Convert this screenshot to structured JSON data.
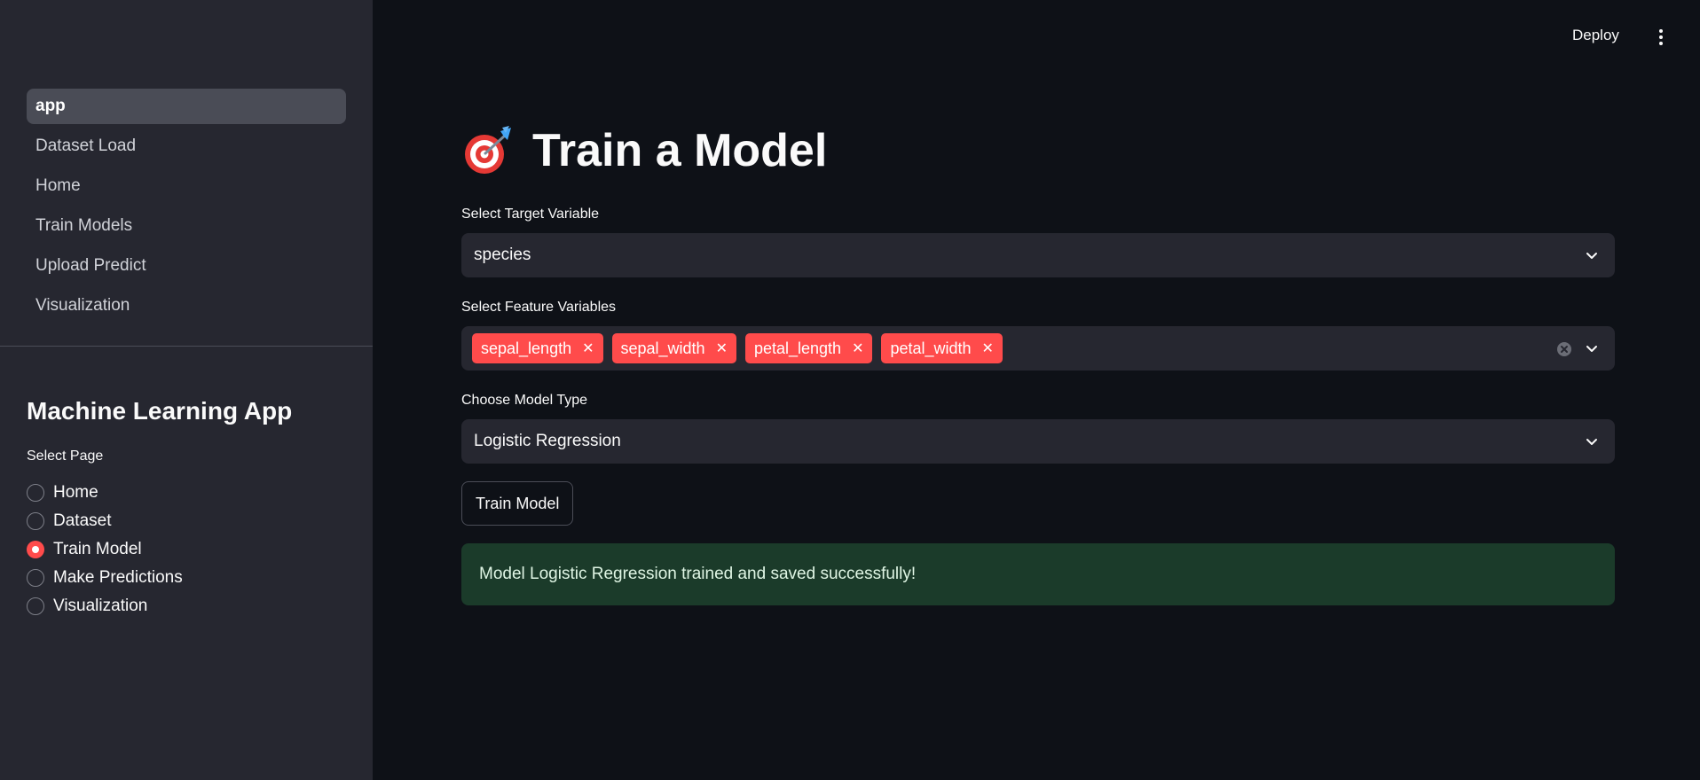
{
  "sidebar": {
    "nav": [
      {
        "label": "app",
        "active": true
      },
      {
        "label": "Dataset Load",
        "active": false
      },
      {
        "label": "Home",
        "active": false
      },
      {
        "label": "Train Models",
        "active": false
      },
      {
        "label": "Upload Predict",
        "active": false
      },
      {
        "label": "Visualization",
        "active": false
      }
    ],
    "title": "Machine Learning App",
    "radio_label": "Select Page",
    "radio_options": [
      {
        "label": "Home",
        "checked": false
      },
      {
        "label": "Dataset",
        "checked": false
      },
      {
        "label": "Train Model",
        "checked": true
      },
      {
        "label": "Make Predictions",
        "checked": false
      },
      {
        "label": "Visualization",
        "checked": false
      }
    ]
  },
  "header": {
    "deploy_label": "Deploy",
    "menu_icon": "kebab-menu-icon"
  },
  "main": {
    "title_icon": "🎯",
    "title": "Train a Model",
    "target": {
      "label": "Select Target Variable",
      "value": "species"
    },
    "features": {
      "label": "Select Feature Variables",
      "tags": [
        "sepal_length",
        "sepal_width",
        "petal_length",
        "petal_width"
      ]
    },
    "model_type": {
      "label": "Choose Model Type",
      "value": "Logistic Regression"
    },
    "train_button": "Train Model",
    "success_message": "Model Logistic Regression trained and saved successfully!"
  },
  "colors": {
    "accent": "#ff4b4b",
    "sidebar_bg": "#262730",
    "main_bg": "#0e1117",
    "success_bg": "#1b3b2a"
  }
}
